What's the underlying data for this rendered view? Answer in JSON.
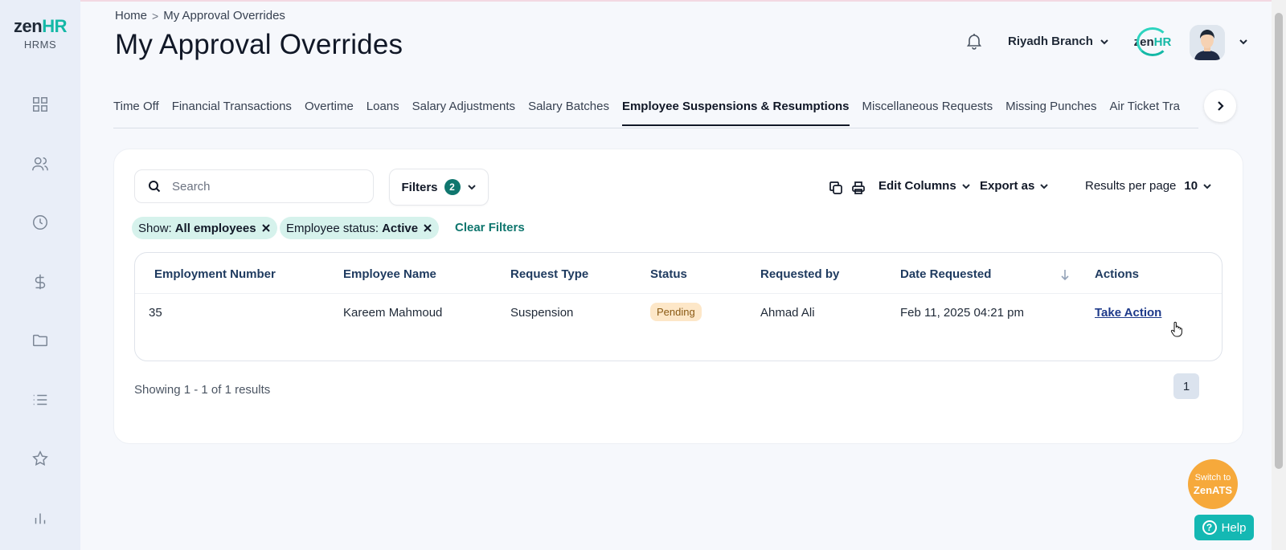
{
  "app": {
    "logo_main": "zen",
    "logo_accent": "HR",
    "logo_sub": "HRMS"
  },
  "sidebar": {
    "icons": [
      "dashboard-icon",
      "people-icon",
      "clock-icon",
      "dollar-icon",
      "folder-icon",
      "list-icon",
      "star-icon",
      "chart-icon"
    ]
  },
  "breadcrumb": {
    "home": "Home",
    "separator": ">",
    "current": "My Approval Overrides"
  },
  "page": {
    "title": "My Approval Overrides"
  },
  "header": {
    "branch": "Riyadh Branch",
    "org_logo_main": "zen",
    "org_logo_accent": "HR"
  },
  "tabs": [
    {
      "label": "Time Off",
      "active": false
    },
    {
      "label": "Financial Transactions",
      "active": false
    },
    {
      "label": "Overtime",
      "active": false
    },
    {
      "label": "Loans",
      "active": false
    },
    {
      "label": "Salary Adjustments",
      "active": false
    },
    {
      "label": "Salary Batches",
      "active": false
    },
    {
      "label": "Employee Suspensions & Resumptions",
      "active": true
    },
    {
      "label": "Miscellaneous Requests",
      "active": false
    },
    {
      "label": "Missing Punches",
      "active": false
    },
    {
      "label": "Air Ticket Tra",
      "active": false
    }
  ],
  "toolbar": {
    "search_placeholder": "Search",
    "filters_label": "Filters",
    "filters_count": "2",
    "edit_columns": "Edit Columns",
    "export_as": "Export as",
    "results_per_page_label": "Results per page",
    "results_per_page_value": "10"
  },
  "active_filters": {
    "chip1_key": "Show:",
    "chip1_value": "All employees",
    "chip2_key": "Employee status:",
    "chip2_value": "Active",
    "clear": "Clear Filters"
  },
  "table": {
    "columns": [
      "Employment Number",
      "Employee Name",
      "Request Type",
      "Status",
      "Requested by",
      "Date Requested",
      "Actions"
    ],
    "rows": [
      {
        "employment_number": "35",
        "employee_name": "Kareem Mahmoud",
        "request_type": "Suspension",
        "status": "Pending",
        "requested_by": "Ahmad Ali",
        "date_requested": "Feb 11, 2025 04:21 pm",
        "action": "Take Action"
      }
    ]
  },
  "pagination": {
    "showing": "Showing 1 - 1 of 1 results",
    "current_page": "1"
  },
  "floating": {
    "switch_line1": "Switch to",
    "switch_line2": "ZenATS",
    "help": "Help",
    "help_glyph": "?"
  },
  "colors": {
    "accent": "#0f766e",
    "chip_bg": "#d6f2ec",
    "pending_bg": "#fde7c8",
    "switch_ats": "#f6a93b",
    "help": "#14b8b3"
  }
}
